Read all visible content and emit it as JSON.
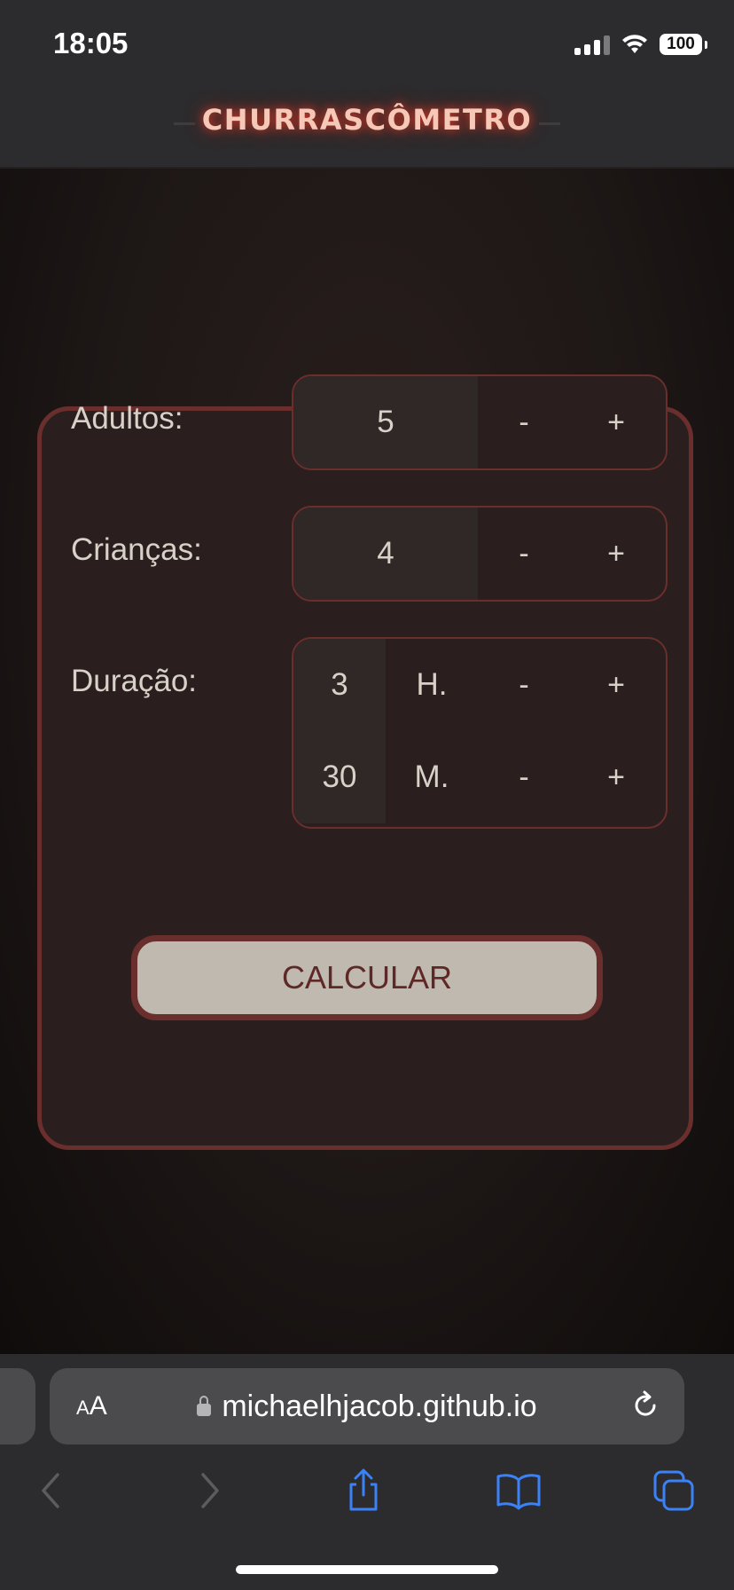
{
  "status_bar": {
    "time": "18:05",
    "battery": "100"
  },
  "header": {
    "title": "CHURRASCÔMETRO"
  },
  "form": {
    "adults": {
      "label": "Adultos:",
      "value": "5",
      "minus": "-",
      "plus": "+"
    },
    "children": {
      "label": "Crianças:",
      "value": "4",
      "minus": "-",
      "plus": "+"
    },
    "duration": {
      "label": "Duração:",
      "hours": {
        "value": "3",
        "unit": "H.",
        "minus": "-",
        "plus": "+"
      },
      "minutes": {
        "value": "30",
        "unit": "M.",
        "minus": "-",
        "plus": "+"
      }
    },
    "calculate_label": "CALCULAR"
  },
  "browser": {
    "aa_label_small": "A",
    "aa_label_large": "A",
    "url": "michaelhjacob.github.io"
  },
  "colors": {
    "accent_border": "#6a2f2d",
    "card_bg": "#2a1f1e",
    "button_bg": "#bfb9b0",
    "button_text": "#5e2826",
    "title_glow": "#c0392b",
    "safari_blue": "#3b82f6"
  },
  "icons": [
    "signal-icon",
    "wifi-icon",
    "battery-icon",
    "lock-icon",
    "reload-icon",
    "back-icon",
    "forward-icon",
    "share-icon",
    "bookmarks-icon",
    "tabs-icon"
  ]
}
